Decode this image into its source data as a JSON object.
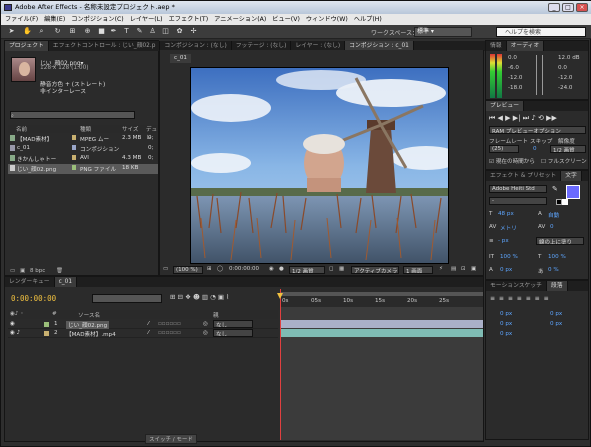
{
  "title": "Adobe After Effects - 名称未設定プロジェクト.aep *",
  "window_buttons": [
    "_",
    "□",
    "×"
  ],
  "menu": [
    "ファイル(F)",
    "編集(E)",
    "コンポジション(C)",
    "レイヤー(L)",
    "エフェクト(T)",
    "アニメーション(A)",
    "ビュー(V)",
    "ウィンドウ(W)",
    "ヘルプ(H)"
  ],
  "toolbar": {
    "workspace_label": "ワークスペース：",
    "workspace_value": "標準",
    "help_placeholder": "ヘルプを検索"
  },
  "project": {
    "tabs": [
      "プロジェクト",
      "エフェクトコントロール : じい_顔02.p",
      "コンポジション : (なし)",
      "フッテージ : (なし)",
      "レイヤー : (なし)",
      "コンポジション : c_01"
    ],
    "thumb_name": "じい_顔02.png▾",
    "thumb_meta": [
      "128 x 128 (1.00)",
      "",
      "静音方色 + (ストレート)",
      "非インターレース"
    ],
    "columns": [
      "名前",
      "種類",
      "サイズ",
      "デュレ"
    ],
    "items": [
      {
        "name": "【MAD素材】",
        "type": "MPEG ムー",
        "size": "2.3 MB",
        "dur": "0;"
      },
      {
        "name": "c_01",
        "type": "コンポジション",
        "size": "",
        "dur": "0;"
      },
      {
        "name": "きかんしゃトー",
        "type": "AVI",
        "size": "4.3 MB",
        "dur": "0;"
      },
      {
        "name": "じい_顔02.png",
        "type": "PNG ファイル",
        "size": "18 KB",
        "dur": ""
      }
    ],
    "bpc": "8 bpc"
  },
  "comp": {
    "tab": "c_01",
    "zoom": "(100 %)",
    "timecode": "0:00:00:00",
    "resolution": "1/2 画質",
    "camera": "アクティブカメラ",
    "views": "1 画面"
  },
  "info": {
    "tabs": [
      "情報",
      "オーディオ"
    ],
    "left": [
      "0.0",
      "-6.0",
      "-12.0",
      "-18.0"
    ],
    "right": [
      "12.0 dB",
      "0.0",
      "-12.0",
      "-24.0"
    ]
  },
  "preview": {
    "tab": "プレビュー",
    "ram": "RAM プレビューオプション",
    "labels": [
      "フレームレート",
      "スキップ",
      "解像度"
    ],
    "values": [
      "(25)",
      "0",
      "1/2 画質"
    ],
    "from_current": "現在の時間から",
    "fullscreen": "フルスクリーン"
  },
  "character": {
    "tabs": [
      "エフェクト & プリセット",
      "文字"
    ],
    "font": "Adobe Heiti Std",
    "style": "-",
    "size": "48 px",
    "leading": "自動",
    "kerning": "メトリ",
    "tracking": "0",
    "stroke_width": "- px",
    "stroke_type": "線の上に塗り",
    "vscale": "100 %",
    "hscale": "100 %",
    "baseline": "0 px",
    "tsume": "0 %",
    "fill_color": "#6b6bff"
  },
  "paragraph": {
    "tabs": [
      "モーションスケッチ",
      "段落"
    ],
    "vals": [
      "0 px",
      "0 px",
      "0 px",
      "0 px",
      "0 px"
    ]
  },
  "timeline": {
    "tabs": [
      "レンダーキュー",
      "c_01"
    ],
    "timecode": "0:00:00:00",
    "header": [
      "#",
      "ソース名",
      "親"
    ],
    "layers": [
      {
        "num": "1",
        "name": "じい_顔02.png",
        "parent": "なし"
      },
      {
        "num": "2",
        "name": "【MAD素材】.mp4",
        "parent": "なし"
      }
    ],
    "ruler": [
      "0s",
      "05s",
      "10s",
      "15s",
      "20s",
      "25s"
    ],
    "footer": "スイッチ / モード"
  }
}
